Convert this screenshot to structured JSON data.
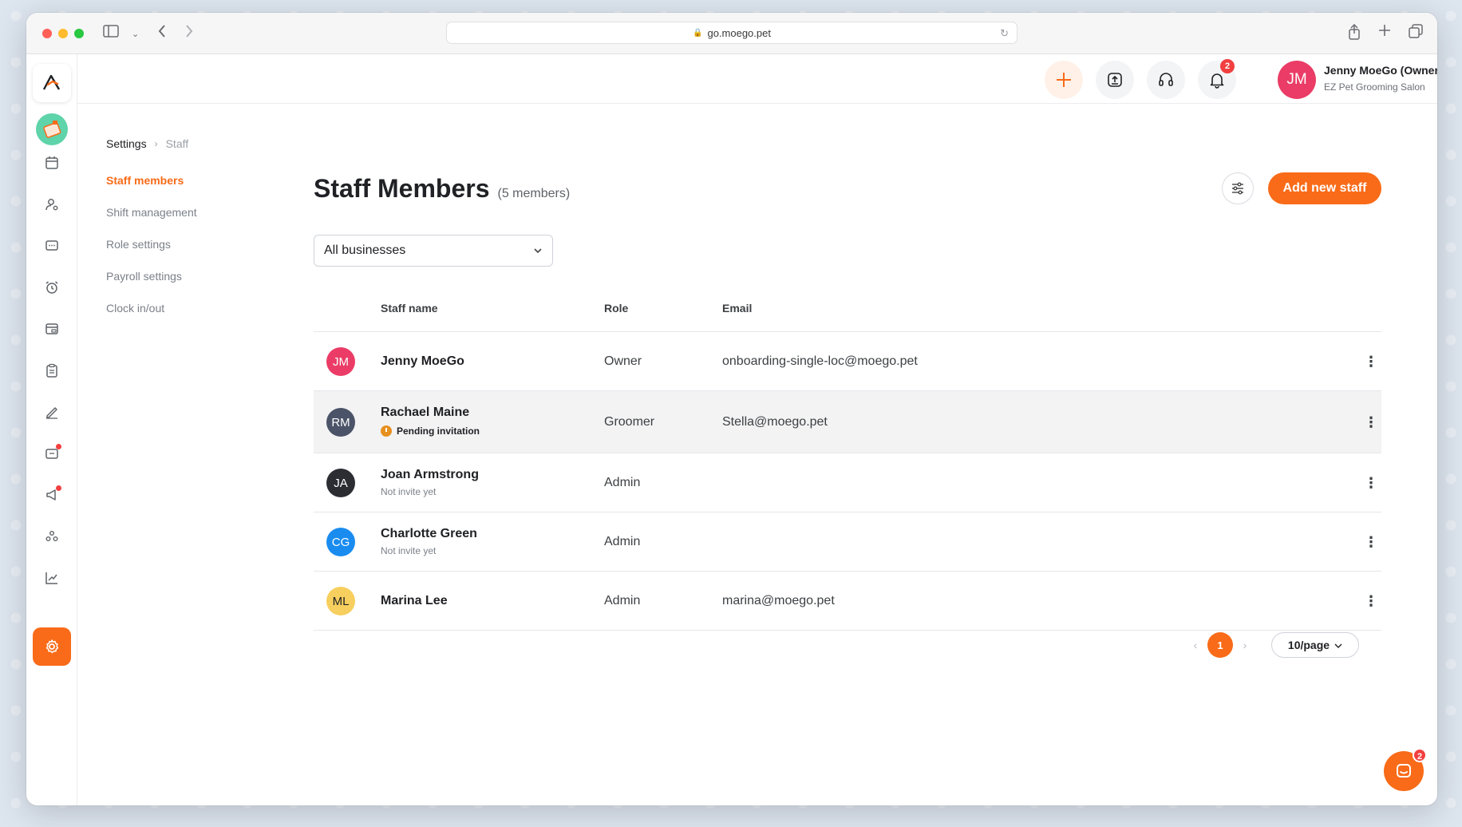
{
  "browser": {
    "url": "go.moego.pet"
  },
  "header": {
    "notification_count": "2",
    "user": {
      "initials": "JM",
      "name": "Jenny MoeGo (Owner)",
      "business": "EZ Pet Grooming Salon",
      "avatar_color": "#ea3c66"
    }
  },
  "breadcrumb": {
    "root": "Settings",
    "current": "Staff"
  },
  "sub_nav": [
    {
      "label": "Staff members",
      "active": true
    },
    {
      "label": "Shift management",
      "active": false
    },
    {
      "label": "Role settings",
      "active": false
    },
    {
      "label": "Payroll settings",
      "active": false
    },
    {
      "label": "Clock in/out",
      "active": false
    }
  ],
  "main": {
    "title": "Staff Members",
    "count": "(5 members)",
    "add_button": "Add new staff",
    "business_filter": "All businesses"
  },
  "table": {
    "columns": {
      "name": "Staff name",
      "role": "Role",
      "email": "Email"
    },
    "rows": [
      {
        "initials": "JM",
        "color": "#ea3c66",
        "name": "Jenny MoeGo",
        "sub": "",
        "pending": "",
        "role": "Owner",
        "email": "onboarding-single-loc@moego.pet"
      },
      {
        "initials": "RM",
        "color": "#4b5368",
        "name": "Rachael Maine",
        "sub": "",
        "pending": "Pending invitation",
        "role": "Groomer",
        "email": "Stella@moego.pet"
      },
      {
        "initials": "JA",
        "color": "#2b2d33",
        "name": "Joan Armstrong",
        "sub": "Not invite yet",
        "pending": "",
        "role": "Admin",
        "email": ""
      },
      {
        "initials": "CG",
        "color": "#1a8cf0",
        "name": "Charlotte Green",
        "sub": "Not invite yet",
        "pending": "",
        "role": "Admin",
        "email": ""
      },
      {
        "initials": "ML",
        "color": "#f7cf5e",
        "name": "Marina Lee",
        "sub": "",
        "pending": "",
        "role": "Admin",
        "email": "marina@moego.pet"
      }
    ]
  },
  "pagination": {
    "current_page": "1",
    "page_size": "10/page"
  },
  "chat": {
    "badge": "2"
  },
  "colors": {
    "accent": "#f96b18",
    "alert": "#f23f3f"
  }
}
